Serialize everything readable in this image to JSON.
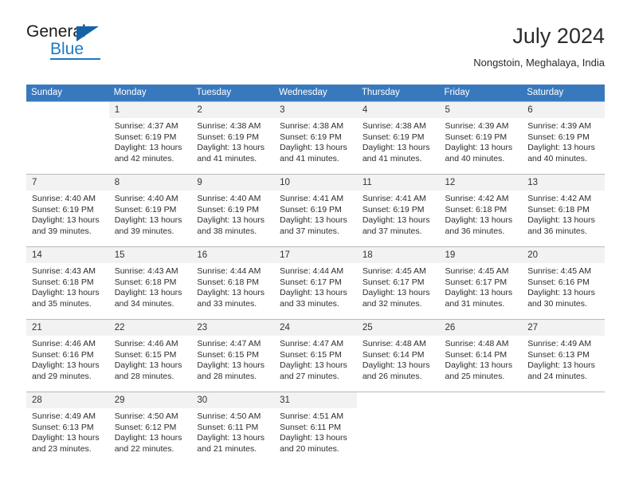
{
  "brand": {
    "line1": "General",
    "line2": "Blue",
    "mark": "triangle-logo"
  },
  "header": {
    "month_year": "July 2024",
    "location": "Nongstoin, Meghalaya, India"
  },
  "colors": {
    "header_row": "#3879be",
    "brand_blue": "#1f7ac4",
    "day_number_bg": "#f2f2f2"
  },
  "weekday_headers": [
    "Sunday",
    "Monday",
    "Tuesday",
    "Wednesday",
    "Thursday",
    "Friday",
    "Saturday"
  ],
  "labels": {
    "sunrise_prefix": "Sunrise:",
    "sunset_prefix": "Sunset:",
    "daylight_prefix": "Daylight:"
  },
  "weeks": [
    [
      {
        "day": "",
        "sunrise": "",
        "sunset": "",
        "daylight_line1": "",
        "daylight_line2": "",
        "blank": true
      },
      {
        "day": "1",
        "sunrise": "Sunrise: 4:37 AM",
        "sunset": "Sunset: 6:19 PM",
        "daylight_line1": "Daylight: 13 hours",
        "daylight_line2": "and 42 minutes.",
        "blank": false
      },
      {
        "day": "2",
        "sunrise": "Sunrise: 4:38 AM",
        "sunset": "Sunset: 6:19 PM",
        "daylight_line1": "Daylight: 13 hours",
        "daylight_line2": "and 41 minutes.",
        "blank": false
      },
      {
        "day": "3",
        "sunrise": "Sunrise: 4:38 AM",
        "sunset": "Sunset: 6:19 PM",
        "daylight_line1": "Daylight: 13 hours",
        "daylight_line2": "and 41 minutes.",
        "blank": false
      },
      {
        "day": "4",
        "sunrise": "Sunrise: 4:38 AM",
        "sunset": "Sunset: 6:19 PM",
        "daylight_line1": "Daylight: 13 hours",
        "daylight_line2": "and 41 minutes.",
        "blank": false
      },
      {
        "day": "5",
        "sunrise": "Sunrise: 4:39 AM",
        "sunset": "Sunset: 6:19 PM",
        "daylight_line1": "Daylight: 13 hours",
        "daylight_line2": "and 40 minutes.",
        "blank": false
      },
      {
        "day": "6",
        "sunrise": "Sunrise: 4:39 AM",
        "sunset": "Sunset: 6:19 PM",
        "daylight_line1": "Daylight: 13 hours",
        "daylight_line2": "and 40 minutes.",
        "blank": false
      }
    ],
    [
      {
        "day": "7",
        "sunrise": "Sunrise: 4:40 AM",
        "sunset": "Sunset: 6:19 PM",
        "daylight_line1": "Daylight: 13 hours",
        "daylight_line2": "and 39 minutes.",
        "blank": false
      },
      {
        "day": "8",
        "sunrise": "Sunrise: 4:40 AM",
        "sunset": "Sunset: 6:19 PM",
        "daylight_line1": "Daylight: 13 hours",
        "daylight_line2": "and 39 minutes.",
        "blank": false
      },
      {
        "day": "9",
        "sunrise": "Sunrise: 4:40 AM",
        "sunset": "Sunset: 6:19 PM",
        "daylight_line1": "Daylight: 13 hours",
        "daylight_line2": "and 38 minutes.",
        "blank": false
      },
      {
        "day": "10",
        "sunrise": "Sunrise: 4:41 AM",
        "sunset": "Sunset: 6:19 PM",
        "daylight_line1": "Daylight: 13 hours",
        "daylight_line2": "and 37 minutes.",
        "blank": false
      },
      {
        "day": "11",
        "sunrise": "Sunrise: 4:41 AM",
        "sunset": "Sunset: 6:19 PM",
        "daylight_line1": "Daylight: 13 hours",
        "daylight_line2": "and 37 minutes.",
        "blank": false
      },
      {
        "day": "12",
        "sunrise": "Sunrise: 4:42 AM",
        "sunset": "Sunset: 6:18 PM",
        "daylight_line1": "Daylight: 13 hours",
        "daylight_line2": "and 36 minutes.",
        "blank": false
      },
      {
        "day": "13",
        "sunrise": "Sunrise: 4:42 AM",
        "sunset": "Sunset: 6:18 PM",
        "daylight_line1": "Daylight: 13 hours",
        "daylight_line2": "and 36 minutes.",
        "blank": false
      }
    ],
    [
      {
        "day": "14",
        "sunrise": "Sunrise: 4:43 AM",
        "sunset": "Sunset: 6:18 PM",
        "daylight_line1": "Daylight: 13 hours",
        "daylight_line2": "and 35 minutes.",
        "blank": false
      },
      {
        "day": "15",
        "sunrise": "Sunrise: 4:43 AM",
        "sunset": "Sunset: 6:18 PM",
        "daylight_line1": "Daylight: 13 hours",
        "daylight_line2": "and 34 minutes.",
        "blank": false
      },
      {
        "day": "16",
        "sunrise": "Sunrise: 4:44 AM",
        "sunset": "Sunset: 6:18 PM",
        "daylight_line1": "Daylight: 13 hours",
        "daylight_line2": "and 33 minutes.",
        "blank": false
      },
      {
        "day": "17",
        "sunrise": "Sunrise: 4:44 AM",
        "sunset": "Sunset: 6:17 PM",
        "daylight_line1": "Daylight: 13 hours",
        "daylight_line2": "and 33 minutes.",
        "blank": false
      },
      {
        "day": "18",
        "sunrise": "Sunrise: 4:45 AM",
        "sunset": "Sunset: 6:17 PM",
        "daylight_line1": "Daylight: 13 hours",
        "daylight_line2": "and 32 minutes.",
        "blank": false
      },
      {
        "day": "19",
        "sunrise": "Sunrise: 4:45 AM",
        "sunset": "Sunset: 6:17 PM",
        "daylight_line1": "Daylight: 13 hours",
        "daylight_line2": "and 31 minutes.",
        "blank": false
      },
      {
        "day": "20",
        "sunrise": "Sunrise: 4:45 AM",
        "sunset": "Sunset: 6:16 PM",
        "daylight_line1": "Daylight: 13 hours",
        "daylight_line2": "and 30 minutes.",
        "blank": false
      }
    ],
    [
      {
        "day": "21",
        "sunrise": "Sunrise: 4:46 AM",
        "sunset": "Sunset: 6:16 PM",
        "daylight_line1": "Daylight: 13 hours",
        "daylight_line2": "and 29 minutes.",
        "blank": false
      },
      {
        "day": "22",
        "sunrise": "Sunrise: 4:46 AM",
        "sunset": "Sunset: 6:15 PM",
        "daylight_line1": "Daylight: 13 hours",
        "daylight_line2": "and 28 minutes.",
        "blank": false
      },
      {
        "day": "23",
        "sunrise": "Sunrise: 4:47 AM",
        "sunset": "Sunset: 6:15 PM",
        "daylight_line1": "Daylight: 13 hours",
        "daylight_line2": "and 28 minutes.",
        "blank": false
      },
      {
        "day": "24",
        "sunrise": "Sunrise: 4:47 AM",
        "sunset": "Sunset: 6:15 PM",
        "daylight_line1": "Daylight: 13 hours",
        "daylight_line2": "and 27 minutes.",
        "blank": false
      },
      {
        "day": "25",
        "sunrise": "Sunrise: 4:48 AM",
        "sunset": "Sunset: 6:14 PM",
        "daylight_line1": "Daylight: 13 hours",
        "daylight_line2": "and 26 minutes.",
        "blank": false
      },
      {
        "day": "26",
        "sunrise": "Sunrise: 4:48 AM",
        "sunset": "Sunset: 6:14 PM",
        "daylight_line1": "Daylight: 13 hours",
        "daylight_line2": "and 25 minutes.",
        "blank": false
      },
      {
        "day": "27",
        "sunrise": "Sunrise: 4:49 AM",
        "sunset": "Sunset: 6:13 PM",
        "daylight_line1": "Daylight: 13 hours",
        "daylight_line2": "and 24 minutes.",
        "blank": false
      }
    ],
    [
      {
        "day": "28",
        "sunrise": "Sunrise: 4:49 AM",
        "sunset": "Sunset: 6:13 PM",
        "daylight_line1": "Daylight: 13 hours",
        "daylight_line2": "and 23 minutes.",
        "blank": false
      },
      {
        "day": "29",
        "sunrise": "Sunrise: 4:50 AM",
        "sunset": "Sunset: 6:12 PM",
        "daylight_line1": "Daylight: 13 hours",
        "daylight_line2": "and 22 minutes.",
        "blank": false
      },
      {
        "day": "30",
        "sunrise": "Sunrise: 4:50 AM",
        "sunset": "Sunset: 6:11 PM",
        "daylight_line1": "Daylight: 13 hours",
        "daylight_line2": "and 21 minutes.",
        "blank": false
      },
      {
        "day": "31",
        "sunrise": "Sunrise: 4:51 AM",
        "sunset": "Sunset: 6:11 PM",
        "daylight_line1": "Daylight: 13 hours",
        "daylight_line2": "and 20 minutes.",
        "blank": false
      },
      {
        "day": "",
        "sunrise": "",
        "sunset": "",
        "daylight_line1": "",
        "daylight_line2": "",
        "blank": true
      },
      {
        "day": "",
        "sunrise": "",
        "sunset": "",
        "daylight_line1": "",
        "daylight_line2": "",
        "blank": true
      },
      {
        "day": "",
        "sunrise": "",
        "sunset": "",
        "daylight_line1": "",
        "daylight_line2": "",
        "blank": true
      }
    ]
  ]
}
